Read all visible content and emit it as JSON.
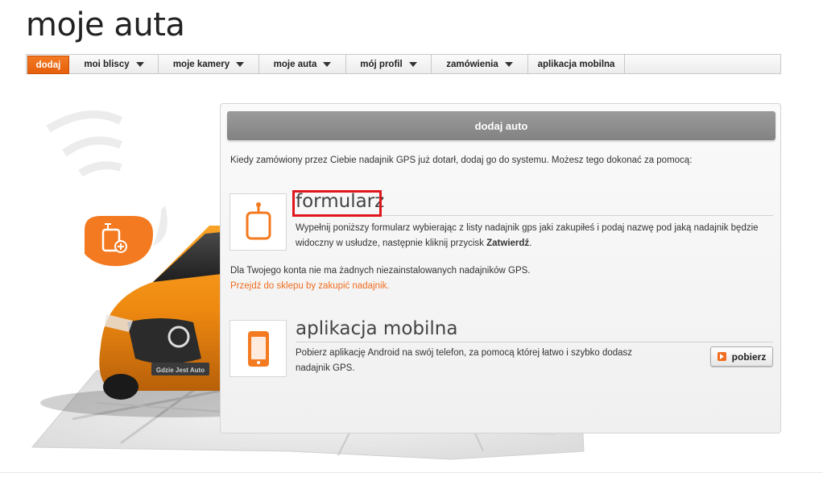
{
  "brand": {
    "title": "moje auta"
  },
  "nav": {
    "items": [
      {
        "label": "dodaj",
        "active": true,
        "dropdown": false
      },
      {
        "label": "moi bliscy",
        "active": false,
        "dropdown": true
      },
      {
        "label": "moje kamery",
        "active": false,
        "dropdown": true
      },
      {
        "label": "moje auta",
        "active": false,
        "dropdown": true
      },
      {
        "label": "mój profil",
        "active": false,
        "dropdown": true
      },
      {
        "label": "zamówienia",
        "active": false,
        "dropdown": true
      },
      {
        "label": "aplikacja mobilna",
        "active": false,
        "dropdown": false
      }
    ]
  },
  "hero": {
    "plate_text": "Gdzie Jest Auto"
  },
  "panel": {
    "header": "dodaj auto",
    "intro": "Kiedy zamówiony przez Ciebie nadajnik GPS już dotarł, dodaj go do systemu. Możesz tego dokonać za pomocą:",
    "form_section": {
      "title": "formularz",
      "text_before": "Wypełnij poniższy formularz wybierając z listy nadajnik gps jaki zakupiłeś i podaj nazwę pod jaką nadajnik będzie widoczny w usłudze, następnie kliknij przycisk ",
      "text_bold": "Zatwierdź",
      "text_after": ".",
      "icon": "gps-device-icon"
    },
    "no_devices": "Dla Twojego konta nie ma żadnych niezainstalowanych nadajników GPS.",
    "shop_link": "Przejdź do sklepu by zakupić nadajnik.",
    "app_section": {
      "title": "aplikacja mobilna",
      "text": "Pobierz aplikację Android na swój telefon, za pomocą której łatwo i szybko dodasz nadajnik GPS.",
      "button": "pobierz",
      "icon": "smartphone-icon"
    }
  },
  "colors": {
    "accent": "#f06c1e",
    "highlight": "#e0161d",
    "header_bg": "#8c8c8c"
  }
}
